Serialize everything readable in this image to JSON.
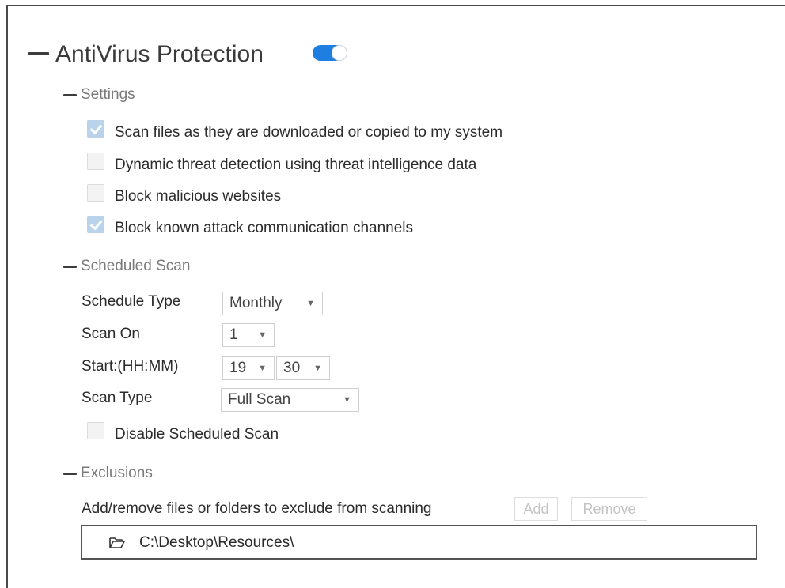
{
  "antivirus": {
    "title": "AntiVirus Protection",
    "enabled": true,
    "accent_color": "#1e7fe0"
  },
  "settings": {
    "title": "Settings",
    "options": [
      {
        "label": "Scan files as they are downloaded or copied to my system",
        "checked": true
      },
      {
        "label": "Dynamic threat detection using threat intelligence data",
        "checked": false
      },
      {
        "label": "Block malicious websites",
        "checked": false
      },
      {
        "label": "Block known attack communication channels",
        "checked": true
      }
    ]
  },
  "scheduled_scan": {
    "title": "Scheduled Scan",
    "schedule_type": {
      "label": "Schedule Type",
      "value": "Monthly"
    },
    "scan_on": {
      "label": "Scan On",
      "value": "1"
    },
    "start": {
      "label": "Start:(HH:MM)",
      "hour": "19",
      "minute": "30"
    },
    "scan_type": {
      "label": "Scan Type",
      "value": "Full Scan"
    },
    "disable": {
      "label": "Disable Scheduled Scan",
      "checked": false
    }
  },
  "exclusions": {
    "title": "Exclusions",
    "description": "Add/remove files or folders to exclude from scanning",
    "add_label": "Add",
    "remove_label": "Remove",
    "items": [
      {
        "path": "C:\\Desktop\\Resources\\",
        "icon": "folder-open-icon"
      }
    ]
  }
}
